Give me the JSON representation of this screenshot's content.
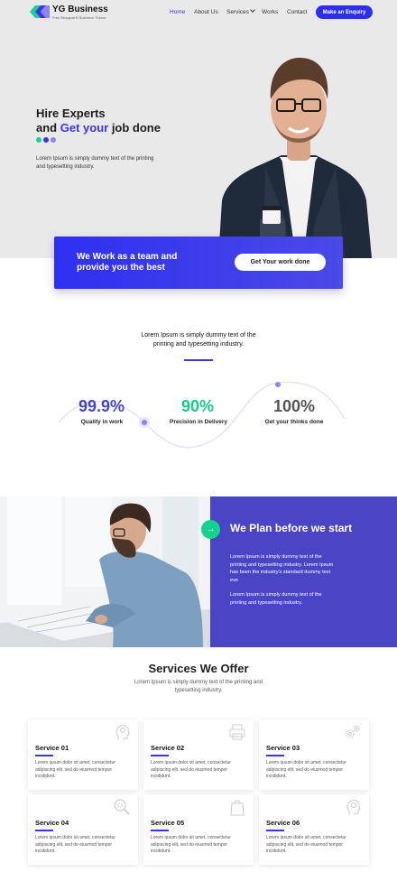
{
  "header": {
    "brand": "YG Business",
    "tagline": "Free Bhagwat B Business Theme",
    "nav": [
      "Home",
      "About Us",
      "Services",
      "Works",
      "Contact"
    ],
    "cta": "Make an Enquiry"
  },
  "hero": {
    "line1": "Hire Experts",
    "line2_pre": "and ",
    "line2_accent": "Get your",
    "line2_post": " job done",
    "text": "Lorem Ipsum is simply dummy text of the printing and typesetting industry.",
    "dot_colors": [
      "#17d18f",
      "#3b35e6",
      "#8a86f0"
    ]
  },
  "banner": {
    "text": "We Work as a team and provide you the best",
    "button": "Get Your work done"
  },
  "intro": {
    "text": "Lorem Ipsum is simply dummy text of the printing and typesetting industry."
  },
  "stats": [
    {
      "value": "99.9%",
      "label": "Quality in work",
      "color": "#4a45c4"
    },
    {
      "value": "90%",
      "label": "Precision in Delivery",
      "color": "#17c98a"
    },
    {
      "value": "100%",
      "label": "Get your thinks done",
      "color": "#555555"
    }
  ],
  "plan": {
    "title": "We Plan before we start",
    "p1": "Lorem Ipsum is simply dummy text of the printing and typesetting industry. Lorem Ipsum has been the industry's standard dummy text eve",
    "p2": "Lorem Ipsum is simply dummy text of the printing and typesetting industry."
  },
  "services": {
    "title": "Services We Offer",
    "subtitle": "Lorem Ipsum is simply dummy text of the printing and typesetting industry.",
    "cards": [
      {
        "title": "Service 01",
        "text": "Lorem ipsum dolor sit amet, consectetur adipiscing elit, sed do eiusmod tempor incididunt.",
        "icon": "head-gear-icon"
      },
      {
        "title": "Service 02",
        "text": "Lorem ipsum dolor sit amet, consectetur adipiscing elit, sed do eiusmod tempor incididunt.",
        "icon": "printer-icon"
      },
      {
        "title": "Service 03",
        "text": "Lorem ipsum dolor sit amet, consectetur adipiscing elit, sed do eiusmod tempor incididunt.",
        "icon": "gears-icon"
      },
      {
        "title": "Service 04",
        "text": "Lorem ipsum dolor sit amet, consectetur adipiscing elit, sed do eiusmod tempor incididunt.",
        "icon": "magnifier-gear-icon"
      },
      {
        "title": "Service 05",
        "text": "Lorem ipsum dolor sit amet, consectetur adipiscing elit, sed do eiusmod tempor incididunt.",
        "icon": "shopping-bag-icon"
      },
      {
        "title": "Service 06",
        "text": "Lorem ipsum dolor sit amet, consectetur adipiscing elit, sed do eiusmod tempor incididunt.",
        "icon": "head-gear-icon"
      }
    ]
  }
}
